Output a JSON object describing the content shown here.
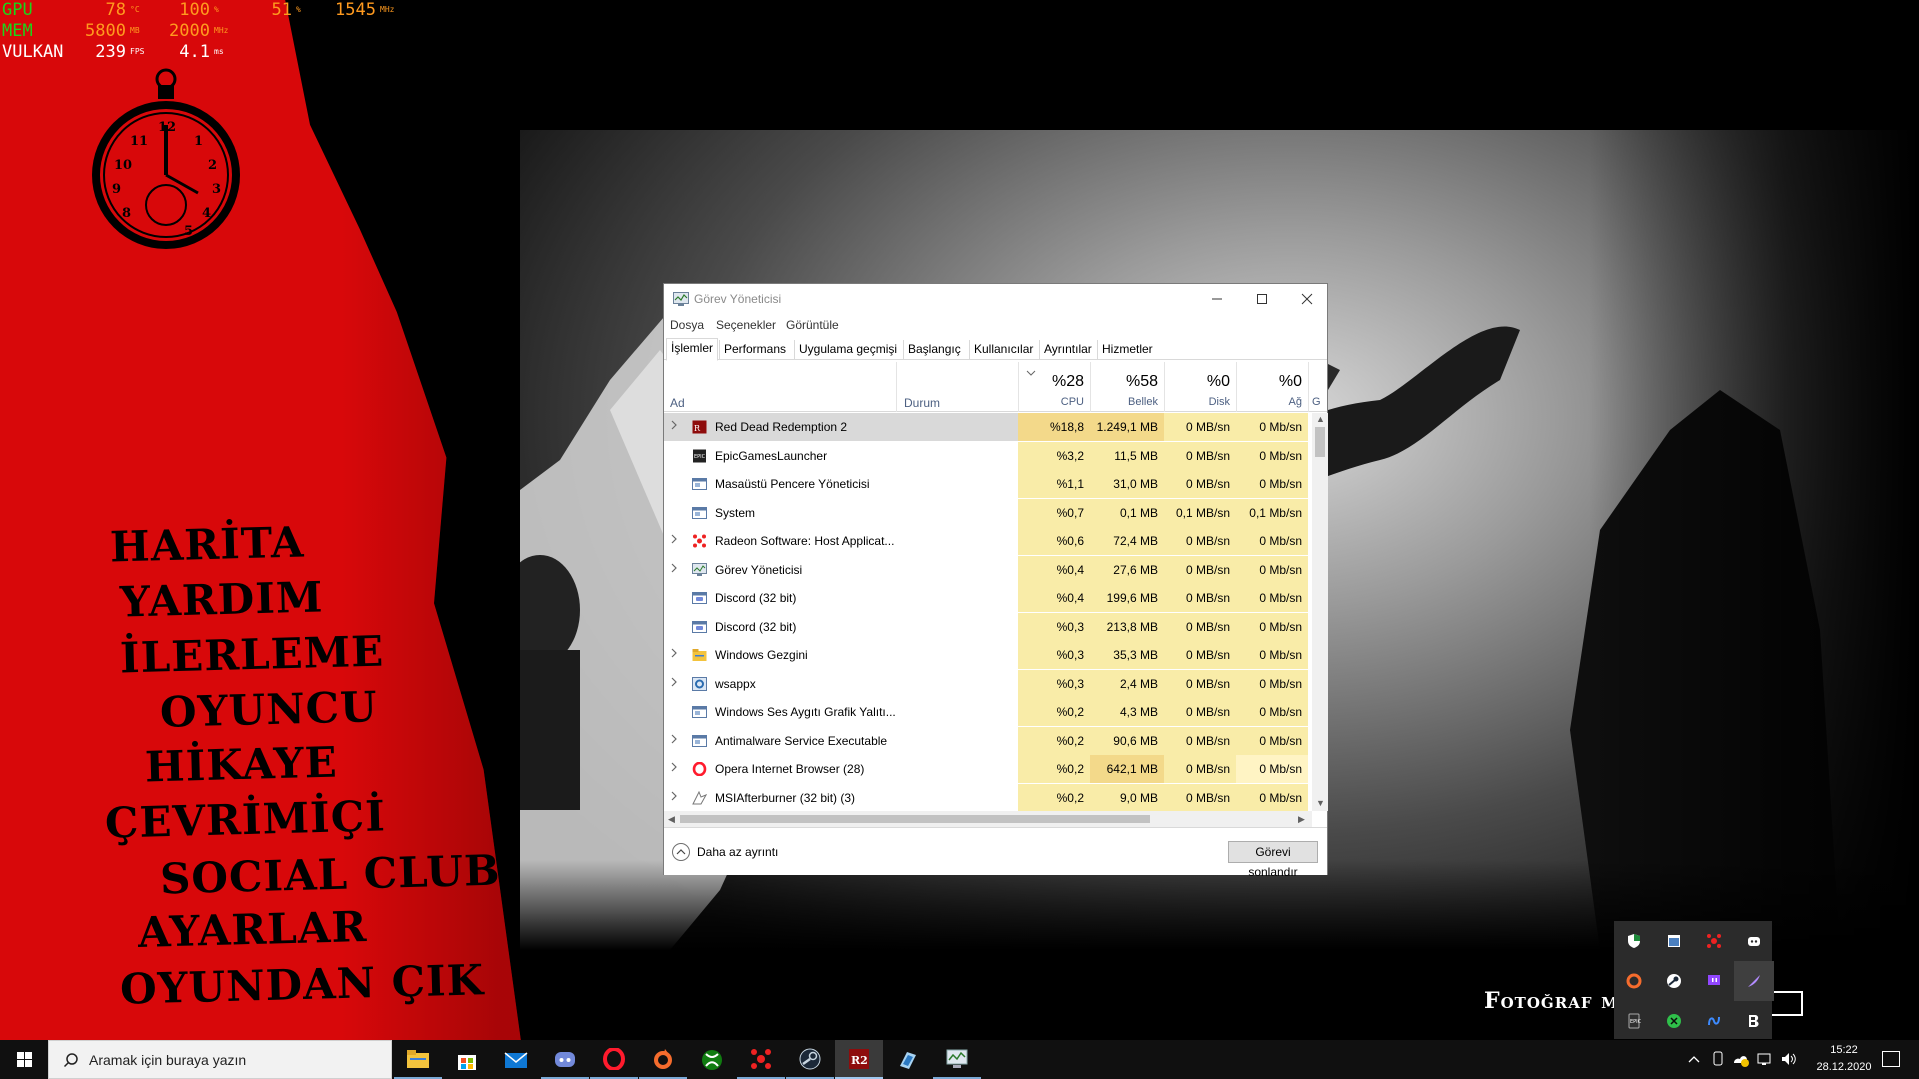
{
  "osd": {
    "gpu": {
      "label": "GPU",
      "temp": "78",
      "temp_unit": "°C",
      "load": "100",
      "load_unit": "%",
      "power": "51",
      "power_unit": "%",
      "clock": "1545",
      "clock_unit": "MHz"
    },
    "mem": {
      "label": "MEM",
      "used": "5800",
      "used_unit": "MB",
      "clock": "2000",
      "clock_unit": "MHz"
    },
    "api": {
      "label": "VULKAN",
      "fps": "239",
      "fps_unit": "FPS",
      "frametime": "4.1",
      "frametime_unit": "ms"
    },
    "colors": {
      "label": "#1bd51b",
      "value": "#ff9a1f"
    }
  },
  "game_menu": {
    "items": [
      "HARİTA",
      "YARDIM",
      "İLERLEME",
      "OYUNCU",
      "HİKAYE",
      "ÇEVRİMİÇİ",
      "SOCIAL CLUB",
      "AYARLAR",
      "OYUNDAN ÇIK"
    ],
    "photo_mode_label": "Fotoğraf mo",
    "accent_color": "#d8080a"
  },
  "task_manager": {
    "title": "Görev Yöneticisi",
    "menu": [
      "Dosya",
      "Seçenekler",
      "Görüntüle"
    ],
    "tabs": [
      "İşlemler",
      "Performans",
      "Uygulama geçmişi",
      "Başlangıç",
      "Kullanıcılar",
      "Ayrıntılar",
      "Hizmetler"
    ],
    "active_tab": "İşlemler",
    "columns": {
      "name": "Ad",
      "status": "Durum",
      "cpu_pct": "%28",
      "cpu": "CPU",
      "mem_pct": "%58",
      "mem": "Bellek",
      "disk_pct": "%0",
      "disk": "Disk",
      "net_pct": "%0",
      "net": "Ağ",
      "gpu_partial": "G"
    },
    "processes": [
      {
        "name": "Red Dead Redemption 2",
        "icon": "rdr2-icon",
        "expandable": true,
        "cpu": "%18,8",
        "mem": "1.249,1 MB",
        "disk": "0 MB/sn",
        "net": "0 Mb/sn"
      },
      {
        "name": "EpicGamesLauncher",
        "icon": "epic-icon",
        "expandable": false,
        "cpu": "%3,2",
        "mem": "11,5 MB",
        "disk": "0 MB/sn",
        "net": "0 Mb/sn"
      },
      {
        "name": "Masaüstü Pencere Yöneticisi",
        "icon": "window-icon",
        "expandable": false,
        "cpu": "%1,1",
        "mem": "31,0 MB",
        "disk": "0 MB/sn",
        "net": "0 Mb/sn"
      },
      {
        "name": "System",
        "icon": "window-icon",
        "expandable": false,
        "cpu": "%0,7",
        "mem": "0,1 MB",
        "disk": "0,1 MB/sn",
        "net": "0,1 Mb/sn"
      },
      {
        "name": "Radeon Software: Host Applicat...",
        "icon": "radeon-icon",
        "expandable": true,
        "cpu": "%0,6",
        "mem": "72,4 MB",
        "disk": "0 MB/sn",
        "net": "0 Mb/sn"
      },
      {
        "name": "Görev Yöneticisi",
        "icon": "taskmgr-icon",
        "expandable": true,
        "cpu": "%0,4",
        "mem": "27,6 MB",
        "disk": "0 MB/sn",
        "net": "0 Mb/sn"
      },
      {
        "name": "Discord (32 bit)",
        "icon": "discord-icon",
        "expandable": false,
        "cpu": "%0,4",
        "mem": "199,6 MB",
        "disk": "0 MB/sn",
        "net": "0 Mb/sn"
      },
      {
        "name": "Discord (32 bit)",
        "icon": "discord-icon",
        "expandable": false,
        "cpu": "%0,3",
        "mem": "213,8 MB",
        "disk": "0 MB/sn",
        "net": "0 Mb/sn"
      },
      {
        "name": "Windows Gezgini",
        "icon": "folder-icon",
        "expandable": true,
        "cpu": "%0,3",
        "mem": "35,3 MB",
        "disk": "0 MB/sn",
        "net": "0 Mb/sn"
      },
      {
        "name": "wsappx",
        "icon": "gear-icon",
        "expandable": true,
        "cpu": "%0,3",
        "mem": "2,4 MB",
        "disk": "0 MB/sn",
        "net": "0 Mb/sn"
      },
      {
        "name": "Windows Ses Aygıtı Grafik Yalıtı...",
        "icon": "window-icon",
        "expandable": false,
        "cpu": "%0,2",
        "mem": "4,3 MB",
        "disk": "0 MB/sn",
        "net": "0 Mb/sn"
      },
      {
        "name": "Antimalware Service Executable",
        "icon": "window-icon",
        "expandable": true,
        "cpu": "%0,2",
        "mem": "90,6 MB",
        "disk": "0 MB/sn",
        "net": "0 Mb/sn"
      },
      {
        "name": "Opera Internet Browser (28)",
        "icon": "opera-icon",
        "expandable": true,
        "cpu": "%0,2",
        "mem": "642,1 MB",
        "disk": "0 MB/sn",
        "net": "0 Mb/sn"
      },
      {
        "name": "MSIAfterburner (32 bit) (3)",
        "icon": "afterburner-icon",
        "expandable": true,
        "cpu": "%0,2",
        "mem": "9,0 MB",
        "disk": "0 MB/sn",
        "net": "0 Mb/sn"
      }
    ],
    "fewer_details": "Daha az ayrıntı",
    "end_task": "Görevi sonlandır"
  },
  "tray_flyout": {
    "icons": [
      "defender-icon",
      "window-app-icon",
      "radeon-icon",
      "discord-icon",
      "origin-icon",
      "steam-icon",
      "twitch-icon",
      "feather-icon",
      "epic-icon",
      "razer-icon",
      "nahimic-icon",
      "bitdefender-icon"
    ]
  },
  "taskbar": {
    "search_placeholder": "Aramak için buraya yazın",
    "apps": [
      "file-explorer-icon",
      "store-icon",
      "mail-icon",
      "discord-icon",
      "opera-icon",
      "origin-icon",
      "xbox-icon",
      "radeon-icon",
      "steam-icon",
      "rdr2-icon",
      "paint-icon",
      "taskmgr-icon"
    ],
    "time": "15:22",
    "date": "28.12.2020"
  }
}
